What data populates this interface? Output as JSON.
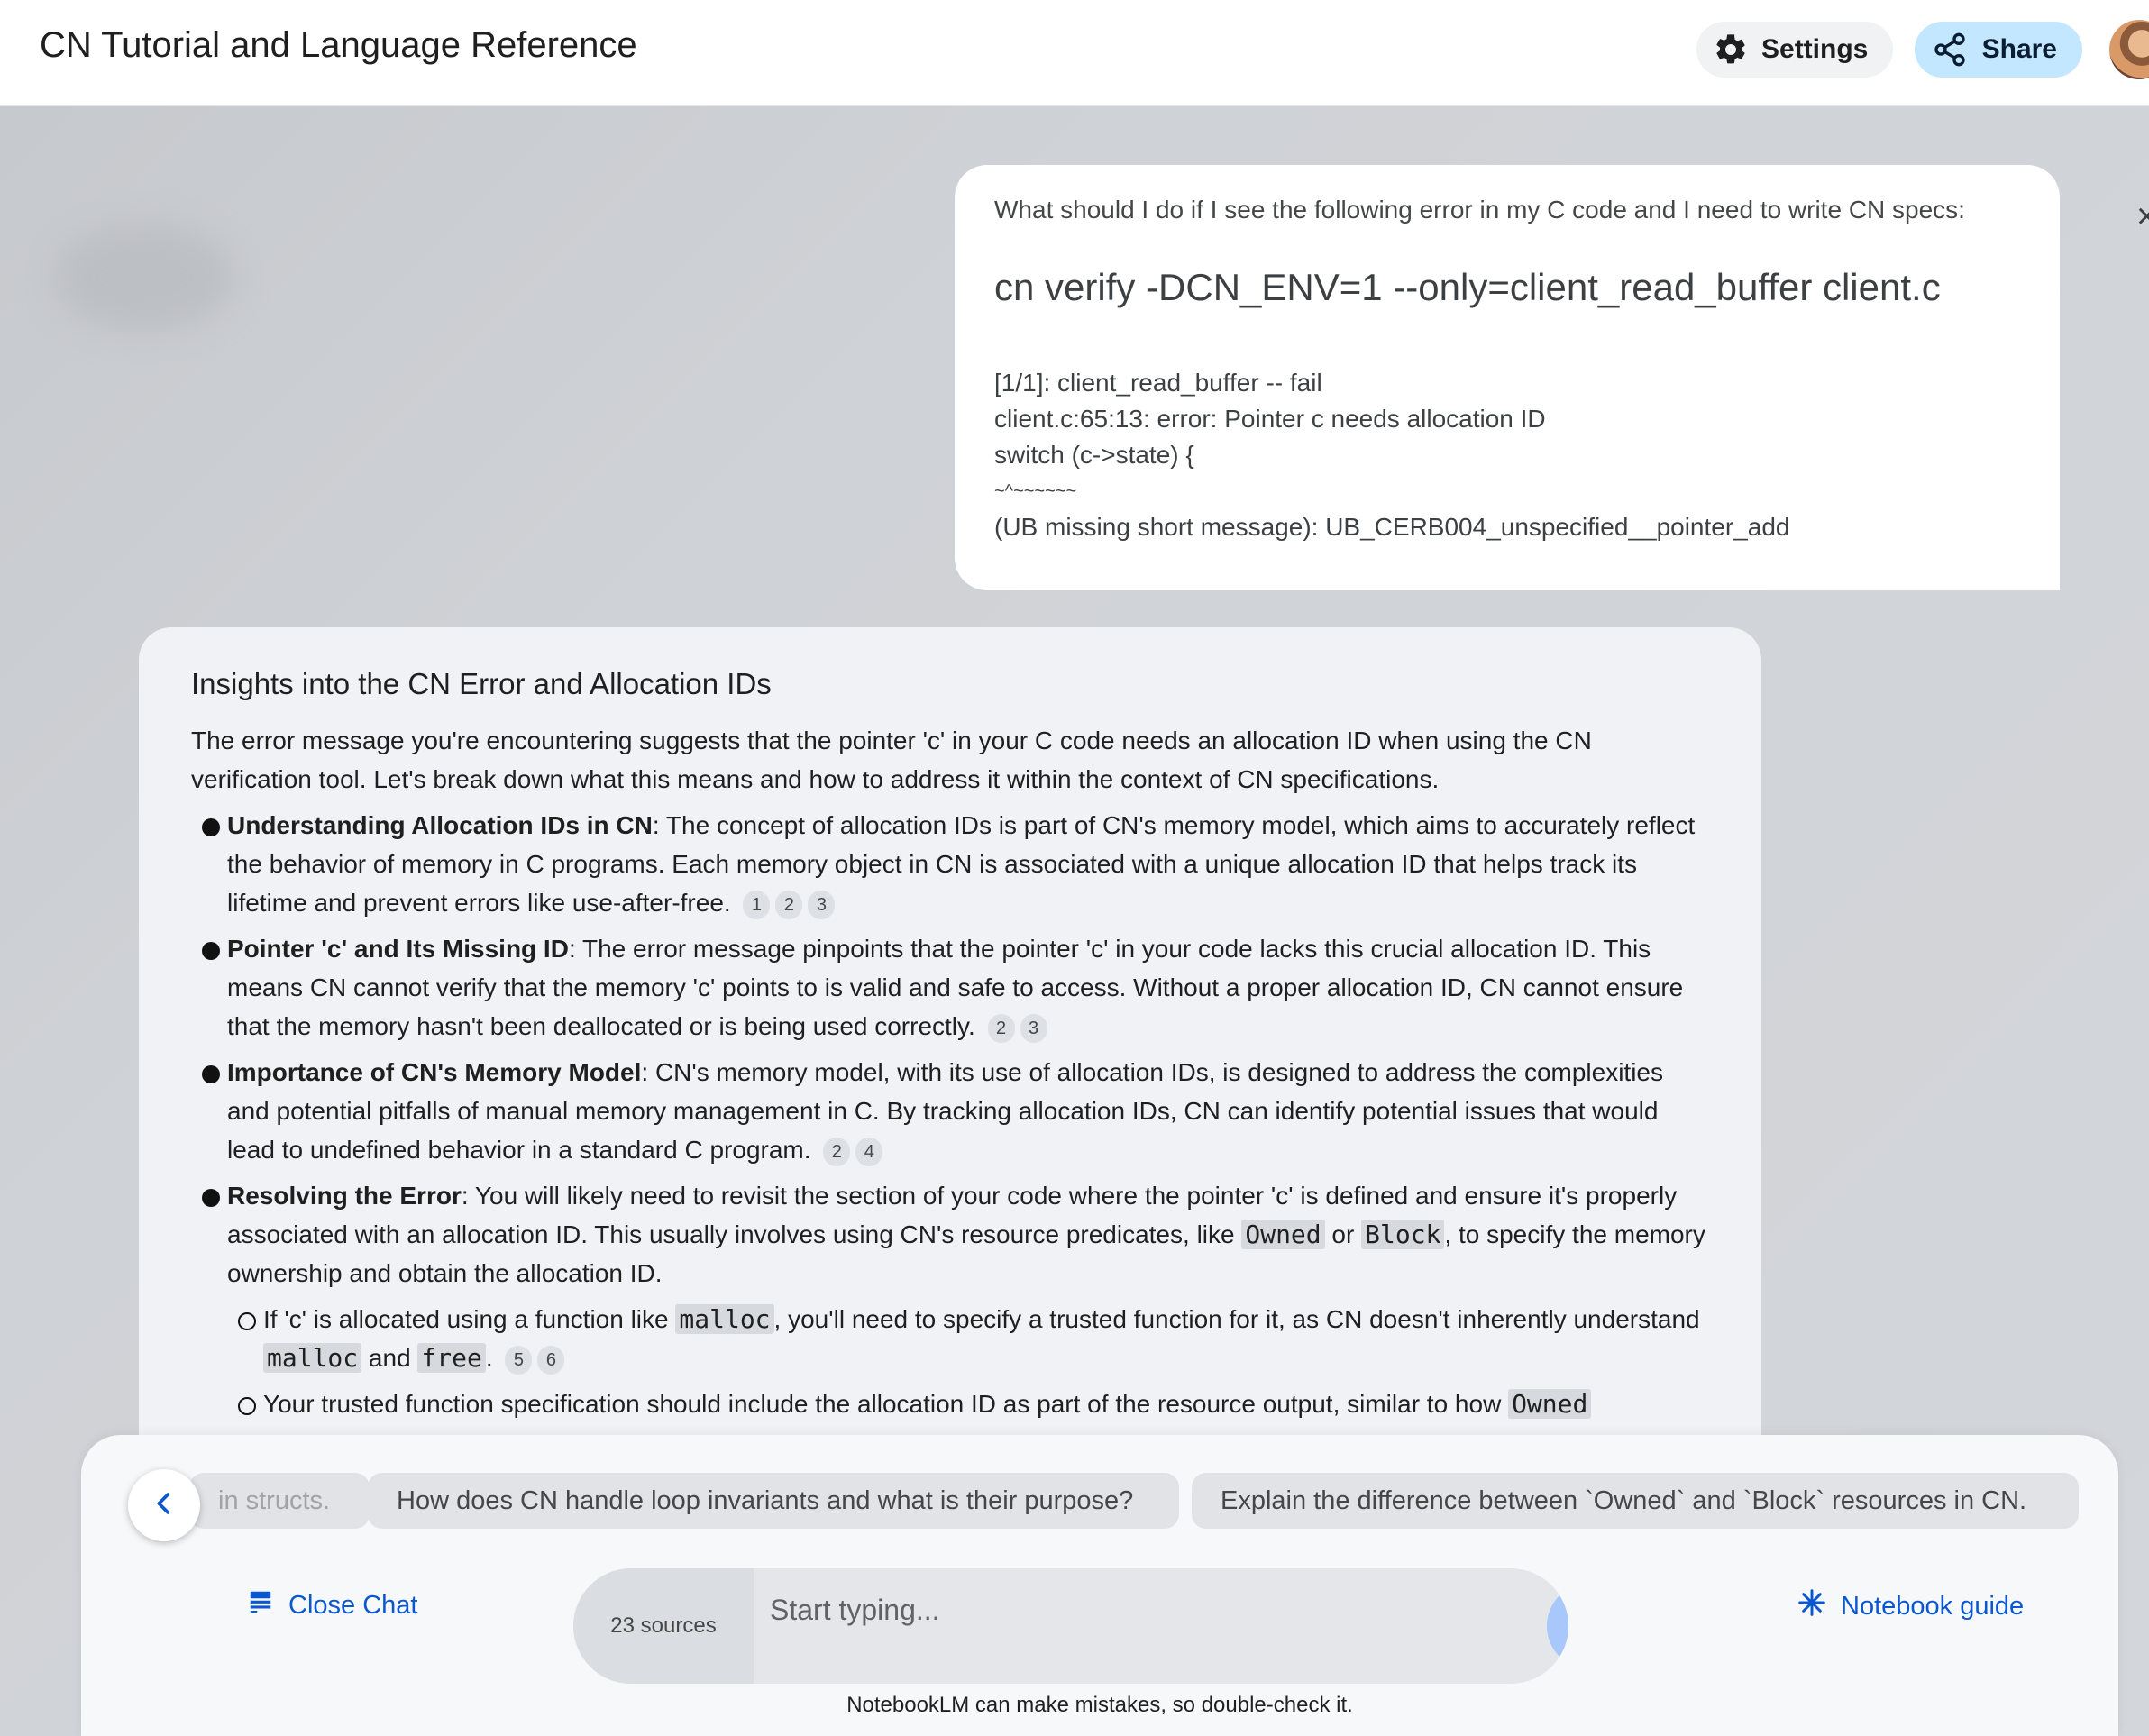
{
  "header": {
    "title": "CN Tutorial and Language Reference",
    "settings_label": "Settings",
    "share_label": "Share"
  },
  "user_message": {
    "question": "What should I do if I see the following error in my C code and I need to write CN specs:",
    "command": "cn verify -DCN_ENV=1 --only=client_read_buffer client.c",
    "log_lines": [
      "[1/1]: client_read_buffer -- fail",
      "client.c:65:13: error: Pointer c needs allocation ID",
      "switch (c->state) {",
      "~^~~~~~~",
      "(UB missing short message): UB_CERB004_unspecified__pointer_add"
    ]
  },
  "answer": {
    "title": "Insights into the CN Error and Allocation IDs",
    "intro": "The error message you're encountering suggests that the pointer 'c' in your C code needs an allocation ID when using the CN verification tool. Let's break down what this means and how to address it within the context of CN specifications.",
    "bullets": [
      {
        "heading": "Understanding Allocation IDs in CN",
        "text": ": The concept of allocation IDs is part of CN's memory model, which aims to accurately reflect the behavior of memory in C programs. Each memory object in CN is associated with a unique allocation ID that helps track its lifetime and prevent errors like use-after-free.",
        "citations": [
          "1",
          "2",
          "3"
        ]
      },
      {
        "heading": "Pointer 'c' and Its Missing ID",
        "text": ": The error message pinpoints that the pointer 'c' in your code lacks this crucial allocation ID. This means CN cannot verify that the memory 'c' points to is valid and safe to access. Without a proper allocation ID, CN cannot ensure that the memory hasn't been deallocated or is being used correctly.",
        "citations": [
          "2",
          "3"
        ]
      },
      {
        "heading": "Importance of CN's Memory Model",
        "text": ": CN's memory model, with its use of allocation IDs, is designed to address the complexities and potential pitfalls of manual memory management in C. By tracking allocation IDs, CN can identify potential issues that would lead to undefined behavior in a standard C program.",
        "citations": [
          "2",
          "4"
        ]
      },
      {
        "heading": "Resolving the Error",
        "text_a": ": You will likely need to revisit the section of your code where the pointer 'c' is defined and ensure it's properly associated with an allocation ID. This usually involves using CN's resource predicates, like ",
        "code_1": "Owned",
        "text_b": " or ",
        "code_2": "Block",
        "text_c": ", to specify the memory ownership and obtain the allocation ID."
      }
    ],
    "sub_bullets": [
      {
        "text_a": "If 'c' is allocated using a function like ",
        "code_1": "malloc",
        "text_b": ", you'll need to specify a trusted function for it, as CN doesn't inherently understand ",
        "code_2": "malloc",
        "text_c": " and ",
        "code_3": "free",
        "text_d": ".",
        "citations": [
          "5",
          "6"
        ]
      },
      {
        "text_a": "Your trusted function specification should include the allocation ID as part of the resource output, similar to how ",
        "code_1": "Owned"
      }
    ]
  },
  "composer": {
    "suggestions": [
      "in structs.",
      "How does CN handle loop invariants and what is their purpose?",
      "Explain the difference between `Owned` and `Block` resources in CN."
    ],
    "close_chat_label": "Close Chat",
    "sources_label": "23 sources",
    "input_placeholder": "Start typing...",
    "notebook_guide_label": "Notebook guide",
    "disclaimer": "NotebookLM can make mistakes, so double-check it."
  },
  "colors": {
    "accent_blue": "#0b57d0",
    "share_bg": "#c2e7ff",
    "send_bg": "#a8c7fa"
  },
  "icons": {
    "settings": "gear-icon",
    "share": "share-icon",
    "close_chat": "chat-panel-icon",
    "notebook_guide": "sparkle-icon",
    "send": "arrow-right-icon",
    "scroll_left": "chevron-left-icon"
  }
}
